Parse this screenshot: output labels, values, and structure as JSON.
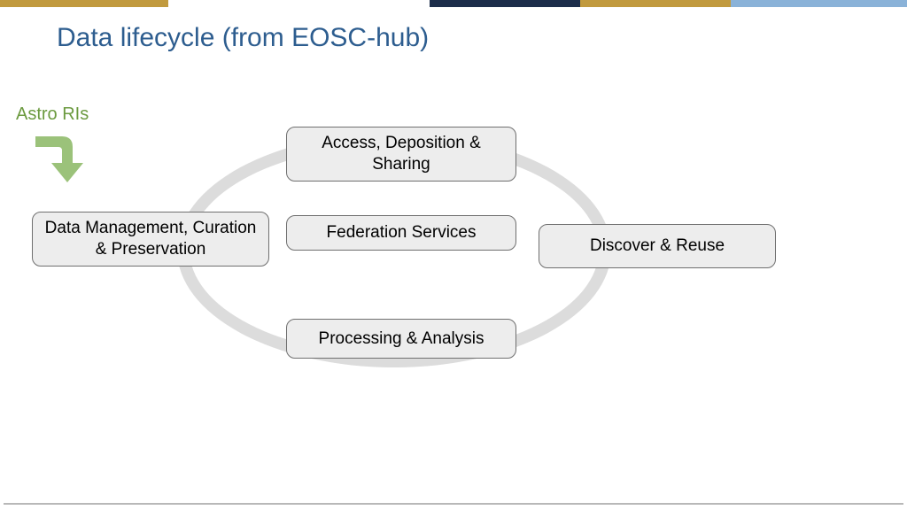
{
  "title": "Data lifecycle (from EOSC-hub)",
  "subtitle": "Astro RIs",
  "colors": {
    "title": "#2d5d8f",
    "subtitle": "#6b9a3f",
    "arrow": "#9bc27a",
    "ellipse": "#dcdcdc",
    "box_bg": "#ededed",
    "box_border": "#6f6f6f",
    "topbar_gold": "#c19a3e",
    "topbar_navy": "#1c2d4a",
    "topbar_blue": "#8ab2d8"
  },
  "boxes": {
    "top": "Access, Deposition & Sharing",
    "center": "Federation Services",
    "bottom": "Processing & Analysis",
    "left": "Data Management, Curation & Preservation",
    "right": "Discover & Reuse"
  }
}
